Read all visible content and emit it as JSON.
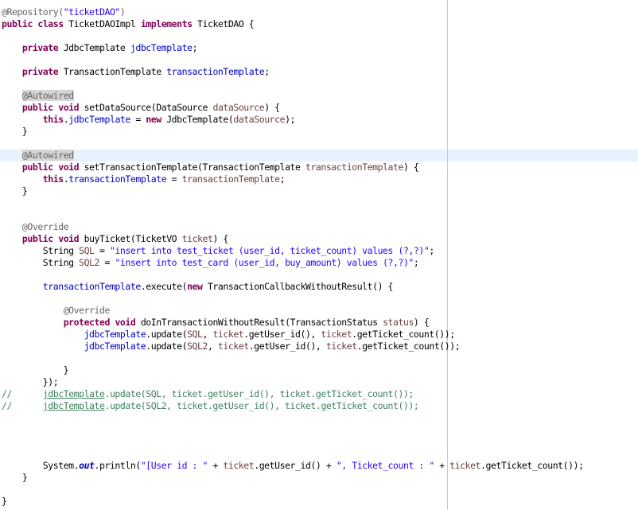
{
  "code": {
    "lines": [
      [
        {
          "t": "@Repository(",
          "c": "a"
        },
        {
          "t": "\"ticketDAO\"",
          "c": "s"
        },
        {
          "t": ")",
          "c": "a"
        }
      ],
      [
        {
          "t": "public",
          "c": "k"
        },
        {
          "t": " "
        },
        {
          "t": "class",
          "c": "k"
        },
        {
          "t": " TicketDAOImpl "
        },
        {
          "t": "implements",
          "c": "k"
        },
        {
          "t": " TicketDAO {"
        }
      ],
      [],
      [
        {
          "t": "    "
        },
        {
          "t": "private",
          "c": "k"
        },
        {
          "t": " JdbcTemplate "
        },
        {
          "t": "jdbcTemplate",
          "c": "f"
        },
        {
          "t": ";"
        }
      ],
      [],
      [
        {
          "t": "    "
        },
        {
          "t": "private",
          "c": "k"
        },
        {
          "t": " TransactionTemplate "
        },
        {
          "t": "transactionTemplate",
          "c": "f"
        },
        {
          "t": ";"
        }
      ],
      [],
      [
        {
          "t": "    "
        },
        {
          "t": "@Autowired",
          "c": "ab"
        }
      ],
      [
        {
          "t": "    "
        },
        {
          "t": "public",
          "c": "k"
        },
        {
          "t": " "
        },
        {
          "t": "void",
          "c": "k"
        },
        {
          "t": " setDataSource(DataSource "
        },
        {
          "t": "dataSource",
          "c": "v"
        },
        {
          "t": ") {"
        }
      ],
      [
        {
          "t": "        "
        },
        {
          "t": "this",
          "c": "k"
        },
        {
          "t": "."
        },
        {
          "t": "jdbcTemplate",
          "c": "f"
        },
        {
          "t": " = "
        },
        {
          "t": "new",
          "c": "k"
        },
        {
          "t": " JdbcTemplate("
        },
        {
          "t": "dataSource",
          "c": "v"
        },
        {
          "t": ");"
        }
      ],
      [
        {
          "t": "    }"
        }
      ],
      [],
      [
        {
          "t": "    "
        },
        {
          "t": "@Autowired",
          "c": "ab"
        }
      ],
      [
        {
          "t": "    "
        },
        {
          "t": "public",
          "c": "k"
        },
        {
          "t": " "
        },
        {
          "t": "void",
          "c": "k"
        },
        {
          "t": " setTransactionTemplate(TransactionTemplate "
        },
        {
          "t": "transactionTemplate",
          "c": "v"
        },
        {
          "t": ") {"
        }
      ],
      [
        {
          "t": "        "
        },
        {
          "t": "this",
          "c": "k"
        },
        {
          "t": "."
        },
        {
          "t": "transactionTemplate",
          "c": "f"
        },
        {
          "t": " = "
        },
        {
          "t": "transactionTemplate",
          "c": "v"
        },
        {
          "t": ";"
        }
      ],
      [
        {
          "t": "    }"
        }
      ],
      [],
      [],
      [
        {
          "t": "    "
        },
        {
          "t": "@Override",
          "c": "a"
        }
      ],
      [
        {
          "t": "    "
        },
        {
          "t": "public",
          "c": "k"
        },
        {
          "t": " "
        },
        {
          "t": "void",
          "c": "k"
        },
        {
          "t": " buyTicket(TicketVO "
        },
        {
          "t": "ticket",
          "c": "v"
        },
        {
          "t": ") {"
        }
      ],
      [
        {
          "t": "        String "
        },
        {
          "t": "SQL",
          "c": "v"
        },
        {
          "t": " = "
        },
        {
          "t": "\"insert into test_ticket (user_id, ticket_count) values (?,?)\"",
          "c": "s"
        },
        {
          "t": ";"
        }
      ],
      [
        {
          "t": "        String "
        },
        {
          "t": "SQL2",
          "c": "v"
        },
        {
          "t": " = "
        },
        {
          "t": "\"insert into test_card (user_id, buy_amount) values (?,?)\"",
          "c": "s"
        },
        {
          "t": ";"
        }
      ],
      [],
      [
        {
          "t": "        "
        },
        {
          "t": "transactionTemplate",
          "c": "f"
        },
        {
          "t": ".execute("
        },
        {
          "t": "new",
          "c": "k"
        },
        {
          "t": " TransactionCallbackWithoutResult() {"
        }
      ],
      [],
      [
        {
          "t": "            "
        },
        {
          "t": "@Override",
          "c": "a"
        }
      ],
      [
        {
          "t": "            "
        },
        {
          "t": "protected",
          "c": "k"
        },
        {
          "t": " "
        },
        {
          "t": "void",
          "c": "k"
        },
        {
          "t": " doInTransactionWithoutResult(TransactionStatus "
        },
        {
          "t": "status",
          "c": "v"
        },
        {
          "t": ") {"
        }
      ],
      [
        {
          "t": "                "
        },
        {
          "t": "jdbcTemplate",
          "c": "f"
        },
        {
          "t": ".update("
        },
        {
          "t": "SQL",
          "c": "v"
        },
        {
          "t": ", "
        },
        {
          "t": "ticket",
          "c": "v"
        },
        {
          "t": ".getUser_id(), "
        },
        {
          "t": "ticket",
          "c": "v"
        },
        {
          "t": ".getTicket_count());"
        }
      ],
      [
        {
          "t": "                "
        },
        {
          "t": "jdbcTemplate",
          "c": "f"
        },
        {
          "t": ".update("
        },
        {
          "t": "SQL2",
          "c": "v"
        },
        {
          "t": ", "
        },
        {
          "t": "ticket",
          "c": "v"
        },
        {
          "t": ".getUser_id(), "
        },
        {
          "t": "ticket",
          "c": "v"
        },
        {
          "t": ".getTicket_count());"
        }
      ],
      [],
      [
        {
          "t": "            }"
        }
      ],
      [
        {
          "t": "        });"
        }
      ],
      [
        {
          "t": "//      ",
          "c": "c"
        },
        {
          "t": "jdbcTemplate",
          "c": "c ul"
        },
        {
          "t": ".update(SQL, ticket.getUser_id(), ticket.getTicket_count());",
          "c": "c"
        }
      ],
      [
        {
          "t": "//      ",
          "c": "c"
        },
        {
          "t": "jdbcTemplate",
          "c": "c ul"
        },
        {
          "t": ".update(SQL2, ticket.getUser_id(), ticket.getTicket_count());",
          "c": "c"
        }
      ],
      [],
      [],
      [],
      [],
      [
        {
          "t": "        System."
        },
        {
          "t": "out",
          "c": "st"
        },
        {
          "t": ".println("
        },
        {
          "t": "\"[User id : \"",
          "c": "s"
        },
        {
          "t": " + "
        },
        {
          "t": "ticket",
          "c": "v"
        },
        {
          "t": ".getUser_id() + "
        },
        {
          "t": "\", Ticket_count : \"",
          "c": "s"
        },
        {
          "t": " + "
        },
        {
          "t": "ticket",
          "c": "v"
        },
        {
          "t": ".getTicket_count());"
        }
      ],
      [
        {
          "t": "    }"
        }
      ],
      [],
      [
        {
          "t": "}"
        }
      ]
    ],
    "highlighted_line": 12
  }
}
